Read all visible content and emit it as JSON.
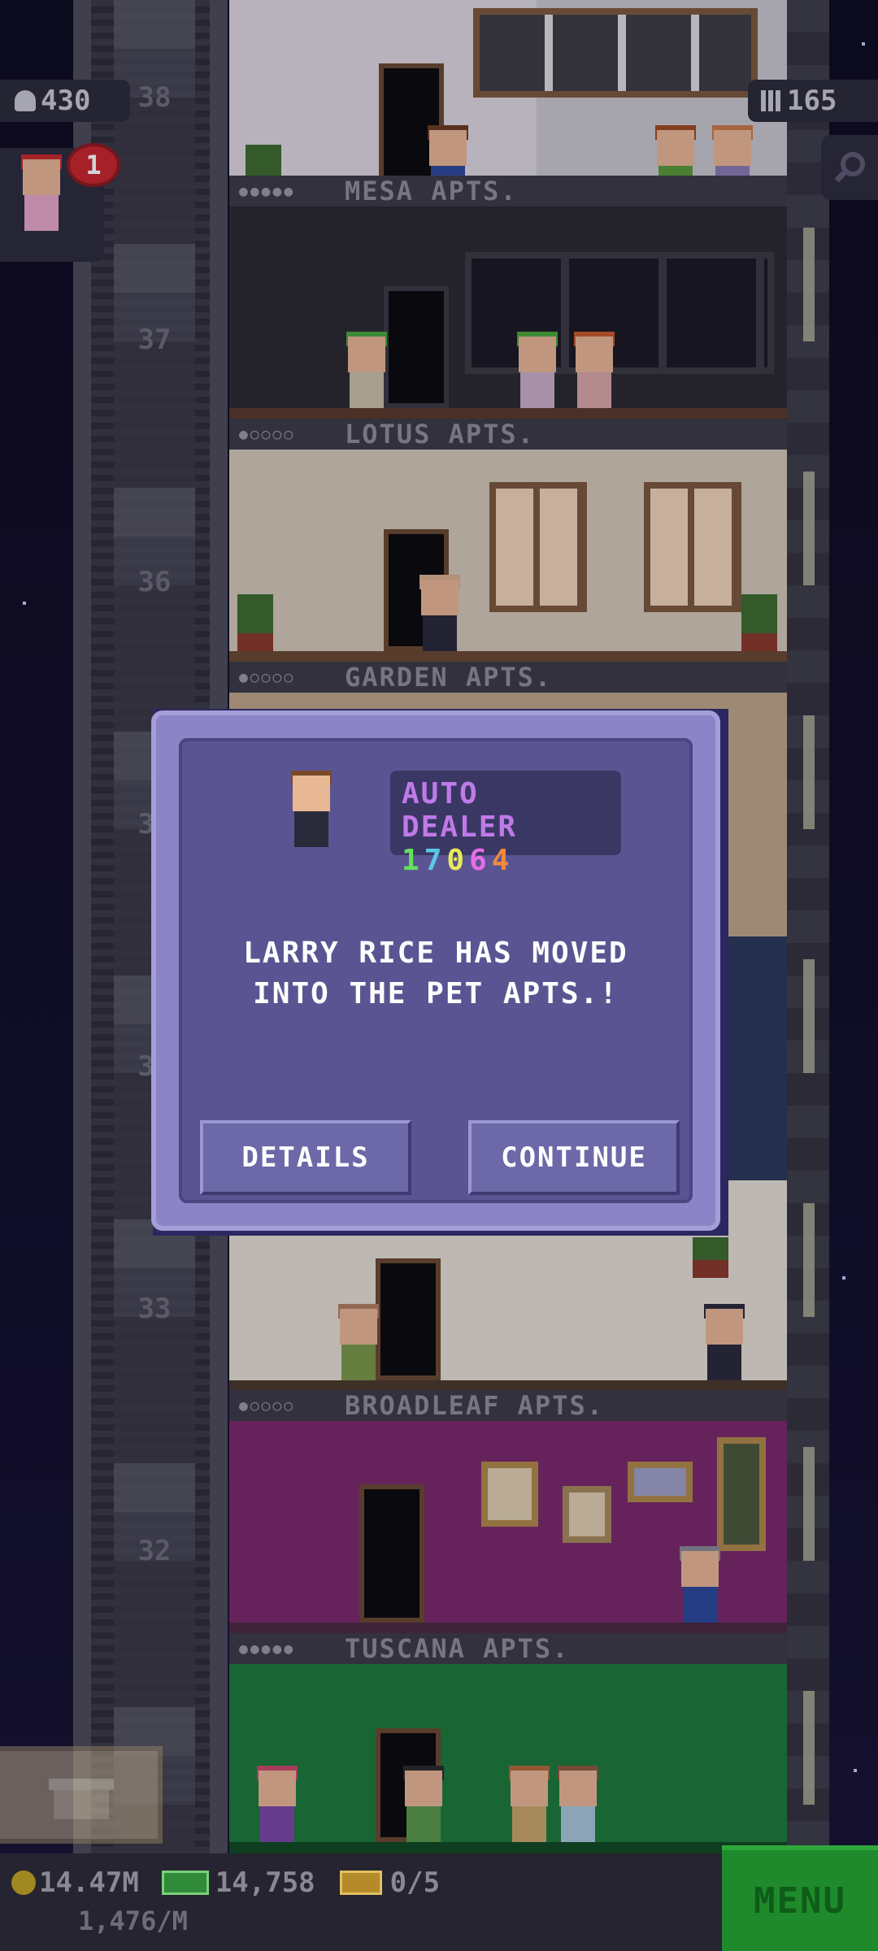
{
  "hud": {
    "population": "430",
    "floors": "165",
    "visitor_count": "1"
  },
  "floor_numbers": [
    "38",
    "37",
    "36",
    "35",
    "34",
    "33",
    "33",
    "32"
  ],
  "floor_labels": [
    "MESA APTS.",
    "LOTUS APTS.",
    "GARDEN APTS.",
    "BROADLEAF APTS.",
    "TUSCANA APTS."
  ],
  "modal": {
    "job_title": "AUTO DEALER",
    "job_digits": [
      "1",
      "7",
      "0",
      "6",
      "4"
    ],
    "message_line1": "LARRY RICE HAS MOVED",
    "message_line2": "INTO THE PET APTS.!",
    "details_label": "DETAILS",
    "continue_label": "CONTINUE"
  },
  "bottom": {
    "coins": "14.47M",
    "bux": "14,758",
    "tickets": "0/5",
    "rate": "1,476/M",
    "menu_label": "MENU"
  },
  "colors": {
    "modal_frame": "#8b84c6",
    "modal_body": "#5a5592",
    "job_title": "#c07ae8",
    "menu_button": "#1e8a2c"
  },
  "icons": [
    "person-icon",
    "building-icon",
    "search-icon",
    "coin-icon",
    "bux-icon",
    "ticket-icon",
    "crate-icon"
  ]
}
